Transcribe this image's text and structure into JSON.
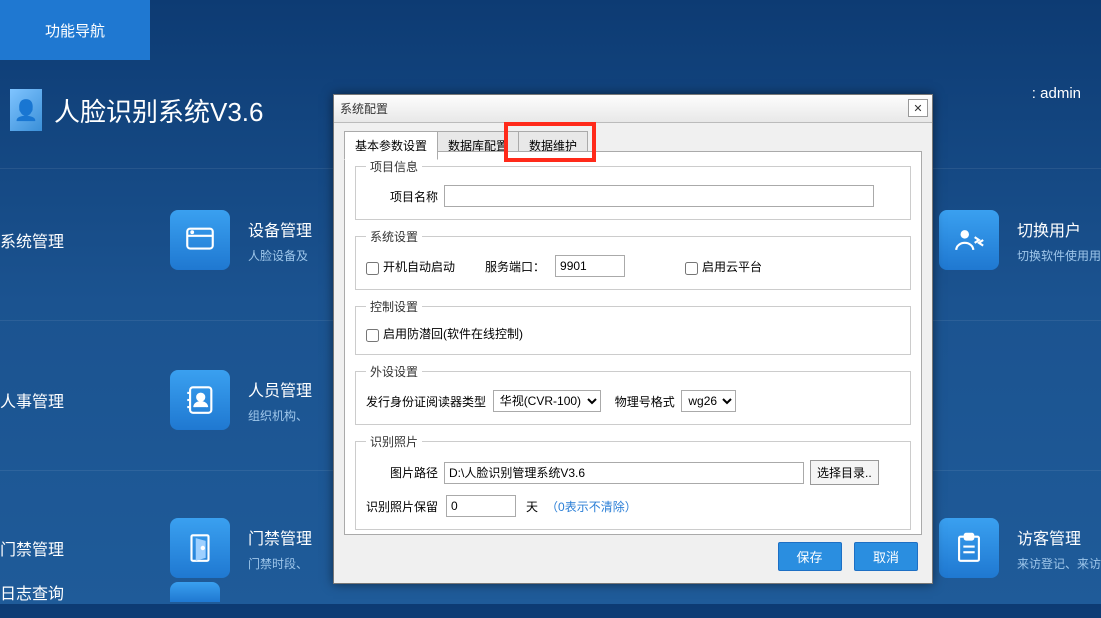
{
  "topTab": "功能导航",
  "title": "人脸识别系统V3.6",
  "adminPrefix": ": ",
  "adminUser": "admin",
  "sections": {
    "s1": {
      "label": "系统管理",
      "tile": {
        "title": "设备管理",
        "sub": "人脸设备及"
      }
    },
    "s2": {
      "label": "人事管理",
      "tile": {
        "title": "人员管理",
        "sub": "组织机构、"
      }
    },
    "s3": {
      "label": "门禁管理",
      "tile": {
        "title": "门禁管理",
        "sub": "门禁时段、"
      }
    },
    "s4": {
      "label": "日志查询"
    }
  },
  "switchUser": {
    "title": "切换用户",
    "sub": "切换软件使用用"
  },
  "visitor": {
    "title": "访客管理",
    "sub": "来访登记、来访"
  },
  "dialog": {
    "title": "系统配置",
    "tabs": {
      "t1": "基本参数设置",
      "t2": "数据库配置",
      "t3": "数据维护"
    },
    "group": {
      "proj": "项目信息",
      "projName": "项目名称",
      "sys": "系统设置",
      "autostart": "开机自动启动",
      "portLbl": "服务端口：",
      "port": "9901",
      "cloud": "启用云平台",
      "ctrl": "控制设置",
      "anti": "启用防潜回(软件在线控制)",
      "periph": "外设设置",
      "readerType": "发行身份证阅读器类型",
      "readerVal": "华视(CVR-100)",
      "wiegandLbl": "物理号格式",
      "wiegandVal": "wg26",
      "photo": "识别照片",
      "pathLbl": "图片路径",
      "pathVal": "D:\\人脸识别管理系统V3.6",
      "dirBtn": "选择目录..",
      "keepLbl": "识别照片保留",
      "keepVal": "0",
      "dayUnit": "天",
      "keepHint": "（0表示不清除）"
    },
    "save": "保存",
    "cancel": "取消"
  }
}
